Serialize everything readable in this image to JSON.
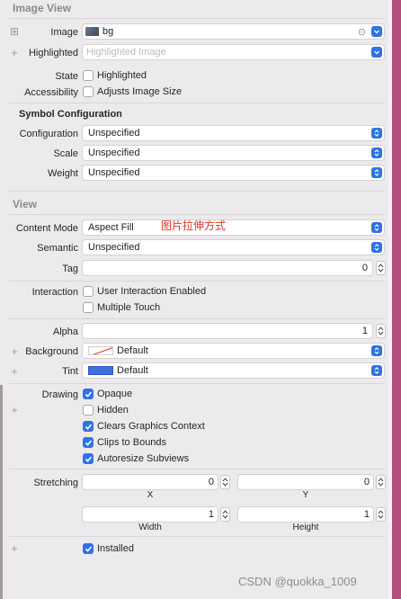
{
  "image_view": {
    "section_title": "Image View",
    "image_label": "Image",
    "image_value": "bg",
    "highlighted_label": "Highlighted",
    "highlighted_placeholder": "Highlighted Image",
    "state_label": "State",
    "state_checkbox": "Highlighted",
    "accessibility_label": "Accessibility",
    "accessibility_checkbox": "Adjusts Image Size"
  },
  "symbol_configuration": {
    "title": "Symbol Configuration",
    "configuration_label": "Configuration",
    "configuration_value": "Unspecified",
    "scale_label": "Scale",
    "scale_value": "Unspecified",
    "weight_label": "Weight",
    "weight_value": "Unspecified"
  },
  "view": {
    "section_title": "View",
    "content_mode_label": "Content Mode",
    "content_mode_value": "Aspect Fill",
    "content_mode_annotation": "图片拉伸方式",
    "semantic_label": "Semantic",
    "semantic_value": "Unspecified",
    "tag_label": "Tag",
    "tag_value": "0",
    "interaction_label": "Interaction",
    "user_interaction": "User Interaction Enabled",
    "multiple_touch": "Multiple Touch",
    "alpha_label": "Alpha",
    "alpha_value": "1",
    "background_label": "Background",
    "background_value": "Default",
    "tint_label": "Tint",
    "tint_value": "Default",
    "drawing_label": "Drawing",
    "opaque": "Opaque",
    "hidden": "Hidden",
    "clears_graphics": "Clears Graphics Context",
    "clips_to_bounds": "Clips to Bounds",
    "autoresize": "Autoresize Subviews",
    "stretching_label": "Stretching",
    "stretch_x_value": "0",
    "stretch_x_caption": "X",
    "stretch_y_value": "0",
    "stretch_y_caption": "Y",
    "stretch_w_value": "1",
    "stretch_w_caption": "Width",
    "stretch_h_value": "1",
    "stretch_h_caption": "Height",
    "installed": "Installed"
  },
  "checkbox_states": {
    "highlighted": false,
    "adjusts_image_size": false,
    "user_interaction": false,
    "multiple_touch": false,
    "opaque": true,
    "hidden": false,
    "clears_graphics": true,
    "clips_to_bounds": true,
    "autoresize": true,
    "installed": true
  },
  "colors": {
    "accent": "#2f72e8",
    "tint_swatch": "#3f6fe0",
    "annotation": "#e0342a"
  },
  "watermark": "CSDN @quokka_1009"
}
